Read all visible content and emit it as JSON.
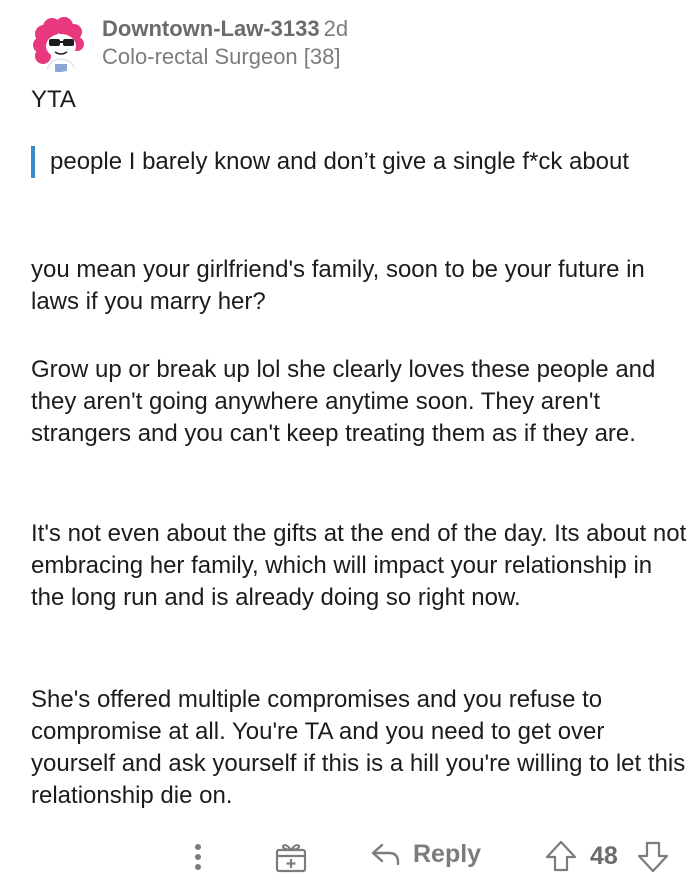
{
  "comment": {
    "username": "Downtown-Law-3133",
    "age": "2d",
    "flair": "Colo-rectal Surgeon [38]",
    "verdict": "YTA",
    "quote": "people I barely know and don’t give a single f*ck about",
    "paragraphs": [
      "you mean your girlfriend's family, soon to be your future in laws if you marry her?",
      "Grow up or break up lol she clearly loves these people and they aren't going anywhere anytime soon. They aren't strangers and you can't keep treating them as if they are.",
      "It's not even about the gifts at the end of the day. Its about not embracing her family, which will impact your relationship in the long run and is already doing so right now.",
      "She's offered multiple compromises and you refuse to compromise at all. You're TA and you need to get over yourself and ask yourself if this is a hill you're willing to let this relationship die on."
    ]
  },
  "actions": {
    "more_icon": "more-vertical-icon",
    "award_icon": "gift-award-icon",
    "reply_icon": "reply-arrow-icon",
    "reply_label": "Reply",
    "upvote_icon": "upvote-arrow-icon",
    "score": "48",
    "downvote_icon": "downvote-arrow-icon"
  },
  "colors": {
    "quote_bar": "#3a8bc8",
    "avatar_background": "#e8387e",
    "muted_text": "#7c7c7c"
  }
}
